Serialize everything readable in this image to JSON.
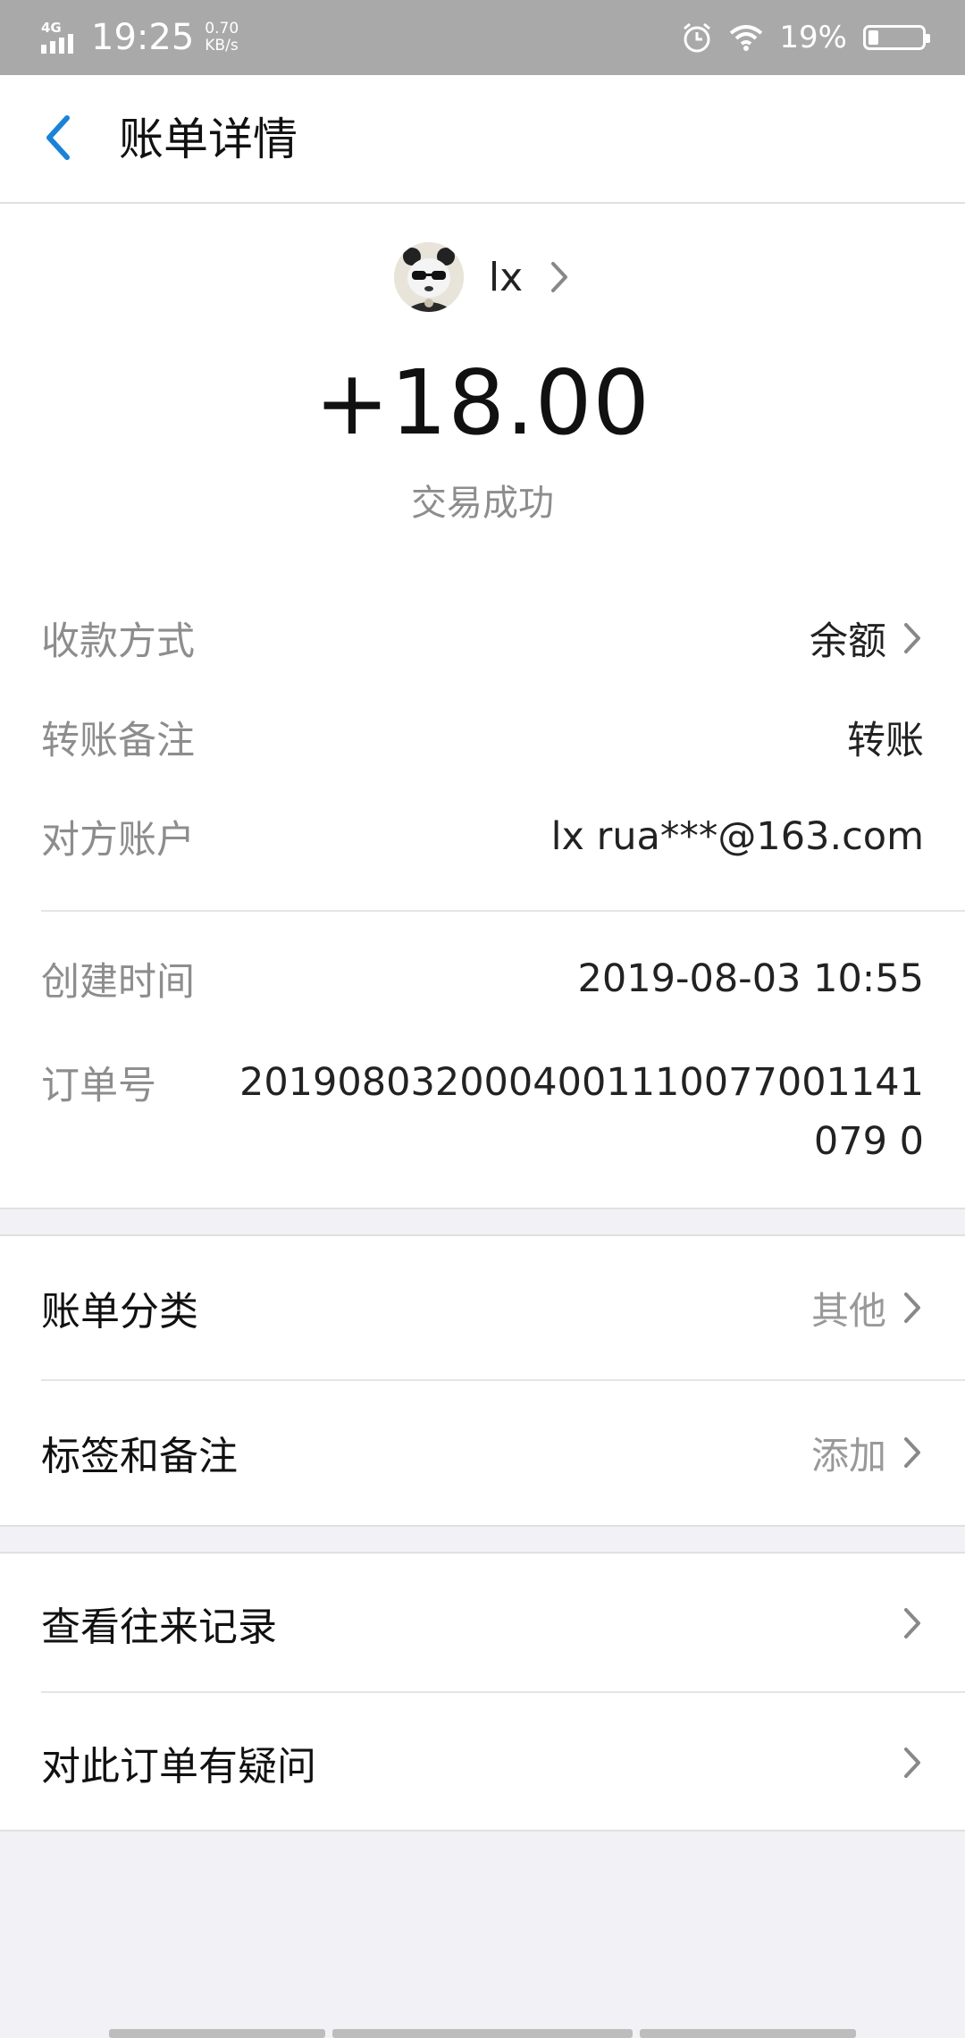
{
  "status_bar": {
    "network": "4G",
    "time": "19:25",
    "speed_value": "0.70",
    "speed_unit": "KB/s",
    "battery_percent": "19%",
    "battery_level": 0.19
  },
  "header": {
    "title": "账单详情"
  },
  "transaction": {
    "payer_name": "lx",
    "amount": "+18.00",
    "status": "交易成功"
  },
  "details": {
    "payment_method_label": "收款方式",
    "payment_method_value": "余额",
    "transfer_note_label": "转账备注",
    "transfer_note_value": "转账",
    "counterparty_label": "对方账户",
    "counterparty_value": "lx rua***@163.com",
    "created_time_label": "创建时间",
    "created_time_value": "2019-08-03 10:55",
    "order_no_label": "订单号",
    "order_no_value": "2019080320004001110077001141079 0"
  },
  "category_card": {
    "bill_category_label": "账单分类",
    "bill_category_value": "其他",
    "tags_notes_label": "标签和备注",
    "tags_notes_value": "添加"
  },
  "actions_card": {
    "view_history_label": "查看往来记录",
    "order_question_label": "对此订单有疑问"
  },
  "colors": {
    "accent": "#1a82d8",
    "status_bar": "#a9a9a9",
    "page_background": "#f2f2f6"
  }
}
